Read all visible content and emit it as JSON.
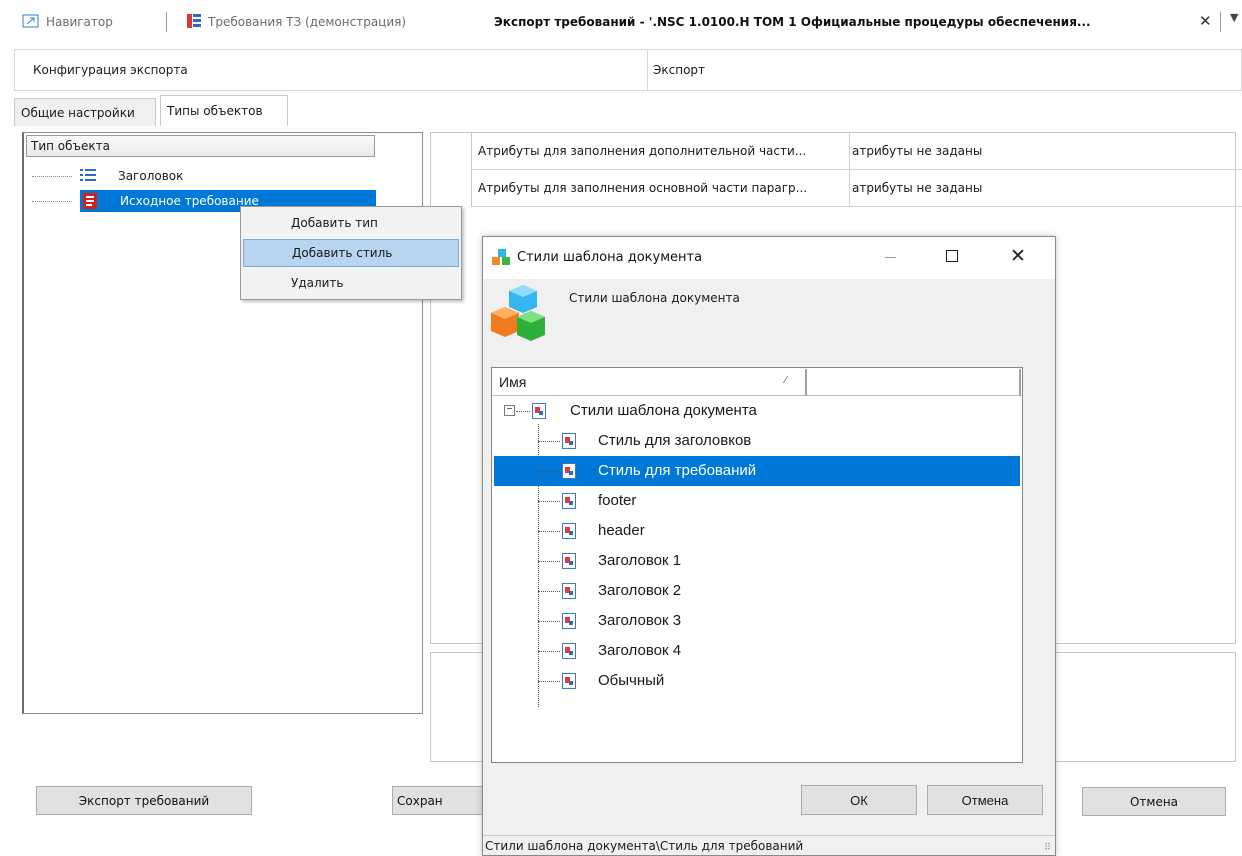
{
  "tabs_top": {
    "navigator": "Навигатор",
    "requirements": "Требования ТЗ (демонстрация)",
    "export_title": "Экспорт требований - '.NSC 1.0100.H TOM 1 Официальные процедуры обеспечения...",
    "close": "✕",
    "overflow": "▼"
  },
  "config": {
    "left": "Конфигурация экспорта",
    "right": "Экспорт"
  },
  "inner_tabs": [
    "Общие настройки",
    "Типы объектов"
  ],
  "tree": {
    "header": "Тип объекта",
    "items": [
      "Заголовок",
      "Исходное требование"
    ]
  },
  "attributes": [
    {
      "key": "Атрибуты для заполнения дополнительной части...",
      "value": "атрибуты не заданы"
    },
    {
      "key": "Атрибуты для заполнения основной части парагр...",
      "value": "атрибуты не заданы"
    }
  ],
  "context_menu": [
    "Добавить тип",
    "Добавить стиль",
    "Удалить"
  ],
  "buttons": {
    "export": "Экспорт требований",
    "save": "Сохран",
    "cancel": "Отмена"
  },
  "dialog": {
    "title": "Стили шаблона документа",
    "heading": "Стили шаблона документа",
    "column_name": "Имя",
    "root": "Стили шаблона документа",
    "items": [
      "Стиль для заголовков",
      "Стиль для требований",
      "footer",
      "header",
      "Заголовок 1",
      "Заголовок 2",
      "Заголовок 3",
      "Заголовок 4",
      "Обычный"
    ],
    "ok": "ОК",
    "cancel": "Отмена",
    "status": "Стили шаблона документа\\Стиль для требований"
  },
  "colors": {
    "selection": "#0078d7",
    "menu_highlight": "#b7d4f0"
  }
}
